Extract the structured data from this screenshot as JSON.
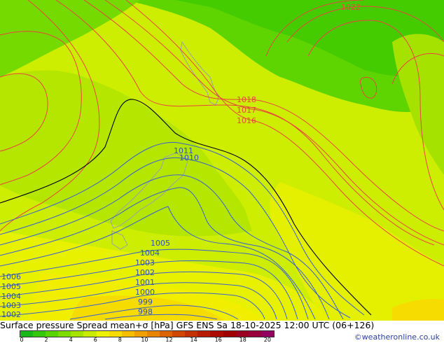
{
  "title": "Surface pressure Spread mean+σ [hPa] GFS ENS  Sa 18-10-2025 12:00 UTC (06+126)",
  "credit": "©weatheronline.co.uk",
  "colorbar": {
    "ticks": [
      "0",
      "2",
      "4",
      "6",
      "8",
      "10",
      "12",
      "14",
      "16",
      "18",
      "20"
    ],
    "colors": [
      "#18b818",
      "#34c80c",
      "#58d400",
      "#7fdc00",
      "#a4e400",
      "#c9ec00",
      "#eef200",
      "#f6dc00",
      "#f6be00",
      "#f0a000",
      "#e88400",
      "#dc6400",
      "#d04800",
      "#c43000",
      "#b81c00",
      "#ac0c00",
      "#a00000",
      "#9c0020",
      "#98003c",
      "#940060"
    ]
  },
  "isobars": {
    "red_labels": [
      "1022",
      "1018",
      "1017",
      "1016"
    ],
    "blue_labels": [
      "1011",
      "1010",
      "1005",
      "1004",
      "1003",
      "1002",
      "1001",
      "1000",
      "999",
      "998",
      "1006",
      "1005",
      "1004",
      "1003",
      "1002"
    ]
  }
}
